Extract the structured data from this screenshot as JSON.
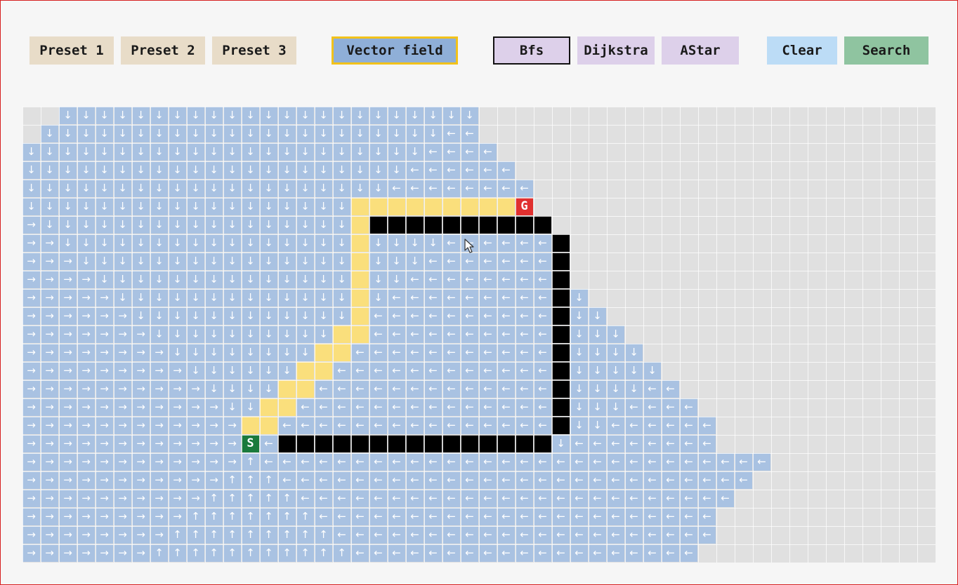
{
  "toolbar": {
    "preset1_label": "Preset 1",
    "preset2_label": "Preset 2",
    "preset3_label": "Preset 3",
    "vector_field_label": "Vector field",
    "bfs_label": "Bfs",
    "dijkstra_label": "Dijkstra",
    "astar_label": "AStar",
    "clear_label": "Clear",
    "search_label": "Search",
    "selected_algorithm": "Bfs"
  },
  "grid": {
    "cols": 50,
    "rows": 25,
    "start_label": "S",
    "goal_label": "G",
    "start": [
      12,
      18
    ],
    "goal": [
      27,
      5
    ],
    "legend_chars": {
      "D": "↓",
      "L": "←",
      "R": "→",
      "U": "↑",
      "#": "wall",
      "p": "path",
      "S": "start",
      "G": "goal",
      ".": "unvisited"
    },
    "cells": [
      "..DDDDDDDDDDDDDDDDDDDDDDD.........................",
      ".DDDDDDDDDDDDDDDDDDDDDDLL.........................",
      "DDDDDDDDDDDDDDDDDDDDDDLLLL........................",
      "DDDDDDDDDDDDDDDDDDDDDLLLLLL.......................",
      "DDDDDDDDDDDDDDDDDDDDLLLLLLLL......................",
      "DDDDDDDDDDDDDDDDDDpppppppppG......................",
      "RDDDDDDDDDDDDDDDDDp##########.....................",
      "RRDDDDDDDDDDDDDDDDpDDDDLLLLLL#....................",
      "RRRDDDDDDDDDDDDDDDpDDDLLLLLLL#....................",
      "RRRRDDDDDDDDDDDDDDpDDLLLLLLLL#....................",
      "RRRRRDDDDDDDDDDDDDpDLLLLLLLLL#D...................",
      "RRRRRRDDDDDDDDDDDDpLLLLLLLLLL#DD..................",
      "RRRRRRRDDDDDDDDDDppLLLLLLLLLL#DDD.................",
      "RRRRRRRRDDDDDDDDppLLLLLLLLLLL#DDDD................",
      "RRRRRRRRRDDDDDDppLLLLLLLLLLLL#DDDDD...............",
      "RRRRRRRRRRDDDDppLLLLLLLLLLLLL#DDDDLL..............",
      "RRRRRRRRRRRDDppLLLLLLLLLLLLLL#DDDLLLL.............",
      "RRRRRRRRRRRRppLLLLLLLLLLLLLLL#DDLLLLLL............",
      "RRRRRRRRRRRRSL###############DLLLLLLLL............",
      "RRRRRRRRRRRRULLLLLLLLLLLLLLLLLLLLLLLLLLLL.........",
      "RRRRRRRRRRRUUULLLLLLLLLLLLLLLLLLLLLLLLLL..........",
      "RRRRRRRRRRUUUUULLLLLLLLLLLLLLLLLLLLLLLL...........",
      "RRRRRRRRRUUUUUUULLLLLLLLLLLLLLLLLLLLLL............",
      "RRRRRRRRUUUUUUUUULLLLLLLLLLLLLLLLLLLLL............",
      "RRRRRRRUUUUUUUUUUULLLLLLLLLLLLLLLLLLL............."
    ]
  },
  "colors": {
    "reached": "#a9c2e2",
    "path": "#fadf7c",
    "wall": "#000000",
    "start": "#1a7a3c",
    "goal": "#e0302f",
    "unvisited": "#e0e0e0"
  }
}
